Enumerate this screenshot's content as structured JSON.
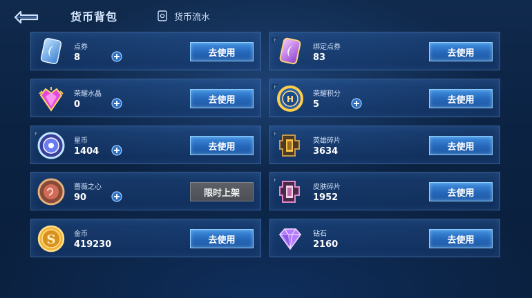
{
  "header": {
    "title": "货币背包",
    "flow_tab_label": "货币流水"
  },
  "colors": {
    "accent_blue": "#2f7ad0",
    "button_border": "#8fd0ff",
    "disabled_button": "#55595f",
    "background": "#0b2242"
  },
  "currencies": [
    {
      "name": "点券",
      "amount": "8",
      "button": "去使用",
      "icon": "voucher-icon",
      "has_plus": true,
      "has_help": false,
      "button_disabled": false
    },
    {
      "name": "绑定点券",
      "amount": "83",
      "button": "去使用",
      "icon": "bound-voucher-icon",
      "has_plus": false,
      "has_help": true,
      "button_disabled": false
    },
    {
      "name": "荣耀水晶",
      "amount": "0",
      "button": "去使用",
      "icon": "glory-crystal-icon",
      "has_plus": true,
      "has_help": false,
      "button_disabled": false
    },
    {
      "name": "荣耀积分",
      "amount": "5",
      "button": "去使用",
      "icon": "glory-points-icon",
      "has_plus": true,
      "has_help": true,
      "button_disabled": false
    },
    {
      "name": "星币",
      "amount": "1404",
      "button": "去使用",
      "icon": "star-coin-icon",
      "has_plus": true,
      "has_help": true,
      "button_disabled": false
    },
    {
      "name": "英雄碎片",
      "amount": "3634",
      "button": "去使用",
      "icon": "hero-fragment-icon",
      "has_plus": false,
      "has_help": true,
      "button_disabled": false
    },
    {
      "name": "蔷薇之心",
      "amount": "90",
      "button": "限时上架",
      "icon": "rose-heart-icon",
      "has_plus": true,
      "has_help": false,
      "button_disabled": true
    },
    {
      "name": "皮肤碎片",
      "amount": "1952",
      "button": "去使用",
      "icon": "skin-fragment-icon",
      "has_plus": false,
      "has_help": true,
      "button_disabled": false
    },
    {
      "name": "金币",
      "amount": "419230",
      "button": "去使用",
      "icon": "gold-coin-icon",
      "has_plus": false,
      "has_help": false,
      "button_disabled": false
    },
    {
      "name": "钻石",
      "amount": "2160",
      "button": "去使用",
      "icon": "diamond-icon",
      "has_plus": false,
      "has_help": false,
      "button_disabled": false
    }
  ]
}
